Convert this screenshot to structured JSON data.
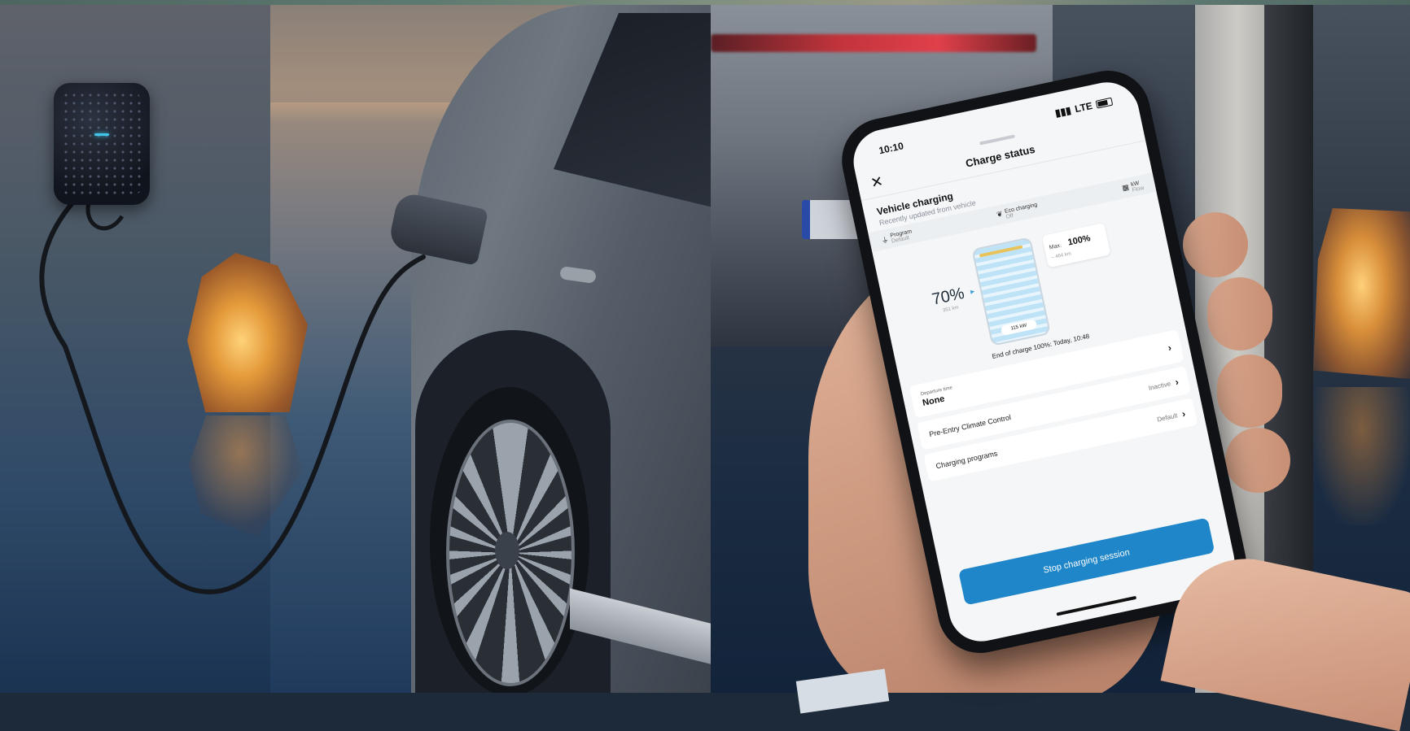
{
  "phone": {
    "status_time": "10:10",
    "status_network": "LTE",
    "header_title": "Charge status",
    "vehicle_charging": {
      "title": "Vehicle charging",
      "subtitle": "Recently updated from vehicle"
    },
    "stats": [
      {
        "label": "Program",
        "sub": "Default"
      },
      {
        "label": "Eco charging",
        "sub": "Off"
      },
      {
        "label": "kW",
        "sub": "Flow"
      }
    ],
    "state_of_charge": "70%",
    "range": "351 km",
    "range_pill": "115 kW",
    "max_label": "Max.",
    "max_value": "100%",
    "max_sub": "– 464 km",
    "end_of_charge": "End of charge 100%: Today, 10:48",
    "departure": {
      "label": "Departure time",
      "value": "None"
    },
    "preentry": {
      "label": "Pre-Entry Climate Control",
      "status": "Inactive"
    },
    "programs": {
      "label": "Charging programs",
      "status": "Default"
    },
    "stop_button": "Stop charging session"
  },
  "colors": {
    "primary_button": "#1f86c9",
    "battery_fill": "#bfe3f6",
    "wallbox_led": "#3fc6e8"
  }
}
